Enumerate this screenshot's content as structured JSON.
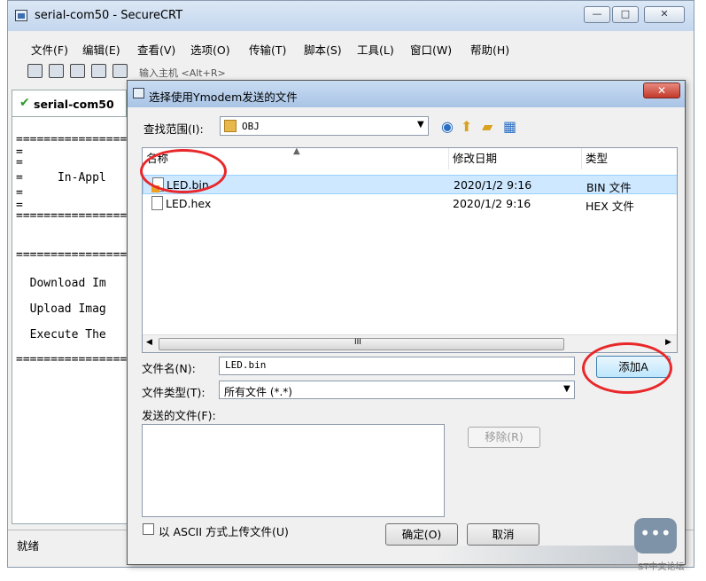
{
  "window": {
    "title": "serial-com50 - SecureCRT",
    "buttons": {
      "minimize": "—",
      "maximize": "□",
      "close": "✕"
    }
  },
  "menubar": {
    "items": [
      "文件(F)",
      "编辑(E)",
      "查看(V)",
      "选项(O)",
      "传输(T)",
      "脚本(S)",
      "工具(L)",
      "窗口(W)",
      "帮助(H)"
    ]
  },
  "toolbar": {
    "quick_connect": "输入主机 <Alt+R>"
  },
  "session_tab": {
    "label": "serial-com50",
    "icon": "check-icon"
  },
  "terminal": {
    "lines": [
      "==================",
      "=",
      "=",
      "=     In-Appl",
      "=",
      "=",
      "==================",
      "==================",
      "  Download Im",
      "  Upload Imag",
      "  Execute The",
      "=================="
    ]
  },
  "statusbar": {
    "text": "就绪"
  },
  "dialog": {
    "title": "选择使用Ymodem发送的文件",
    "close_label": "✕",
    "look_in_label": "查找范围(I):",
    "look_in_value": "OBJ",
    "columns": {
      "name": "名称",
      "modified": "修改日期",
      "type": "类型"
    },
    "files": [
      {
        "name": "LED.bin",
        "date": "2020/1/2 9:16",
        "type": "BIN 文件"
      },
      {
        "name": "LED.hex",
        "date": "2020/1/2 9:16",
        "type": "HEX 文件"
      }
    ],
    "scroll_grip": "III",
    "filename_label": "文件名(N):",
    "filename_value": "LED.bin",
    "filetype_label": "文件类型(T):",
    "filetype_value": "所有文件 (*.*)",
    "add_button": "添加A",
    "send_files_label": "发送的文件(F):",
    "remove_button": "移除(R)",
    "ascii_label": "以 ASCII 方式上传文件(U)",
    "ok_button": "确定(O)",
    "cancel_button": "取消"
  },
  "watermark": {
    "text": "ST中文论坛",
    "bubble": "•••"
  },
  "colors": {
    "annotation": "#e8282a",
    "selection": "#cde8ff",
    "accent": "#3c7fb1"
  }
}
